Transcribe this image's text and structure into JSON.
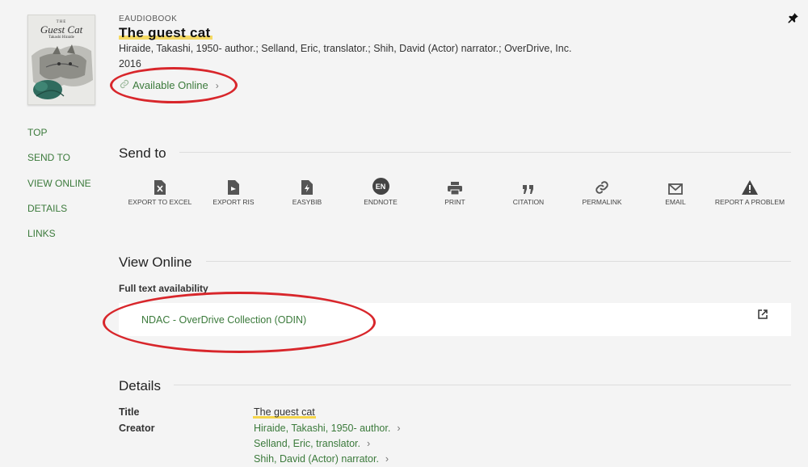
{
  "record": {
    "type": "EAUDIOBOOK",
    "title": "The guest cat",
    "creators_line": "Hiraide, Takashi, 1950- author.; Selland, Eric, translator.; Shih, David (Actor) narrator.; OverDrive, Inc.",
    "year": "2016",
    "availability": "Available Online"
  },
  "cover": {
    "the": "THE",
    "title": "Guest Cat",
    "author": "Takashi Hiraide"
  },
  "nav": [
    "TOP",
    "SEND TO",
    "VIEW ONLINE",
    "DETAILS",
    "LINKS"
  ],
  "send_to": {
    "heading": "Send to",
    "actions": [
      {
        "label": "EXPORT TO EXCEL",
        "icon": "excel-file-icon"
      },
      {
        "label": "EXPORT RIS",
        "icon": "ris-file-icon"
      },
      {
        "label": "EASYBIB",
        "icon": "easybib-icon"
      },
      {
        "label": "ENDNOTE",
        "icon": "endnote-icon",
        "badge": "EN"
      },
      {
        "label": "PRINT",
        "icon": "printer-icon"
      },
      {
        "label": "CITATION",
        "icon": "quote-icon"
      },
      {
        "label": "PERMALINK",
        "icon": "link-icon"
      },
      {
        "label": "EMAIL",
        "icon": "envelope-icon"
      },
      {
        "label": "REPORT A PROBLEM",
        "icon": "warning-icon"
      }
    ]
  },
  "view_online": {
    "heading": "View Online",
    "subheading": "Full text availability",
    "link": "NDAC - OverDrive Collection (ODIN)"
  },
  "details": {
    "heading": "Details",
    "title_label": "Title",
    "title_value": "The guest cat",
    "creator_label": "Creator",
    "creators": [
      "Hiraide, Takashi, 1950- author.",
      "Selland, Eric, translator.",
      "Shih, David (Actor) narrator."
    ]
  },
  "colors": {
    "link_green": "#3b7a3b",
    "annotation_red": "#d8262b",
    "highlight_yellow": "#f5d54a"
  }
}
